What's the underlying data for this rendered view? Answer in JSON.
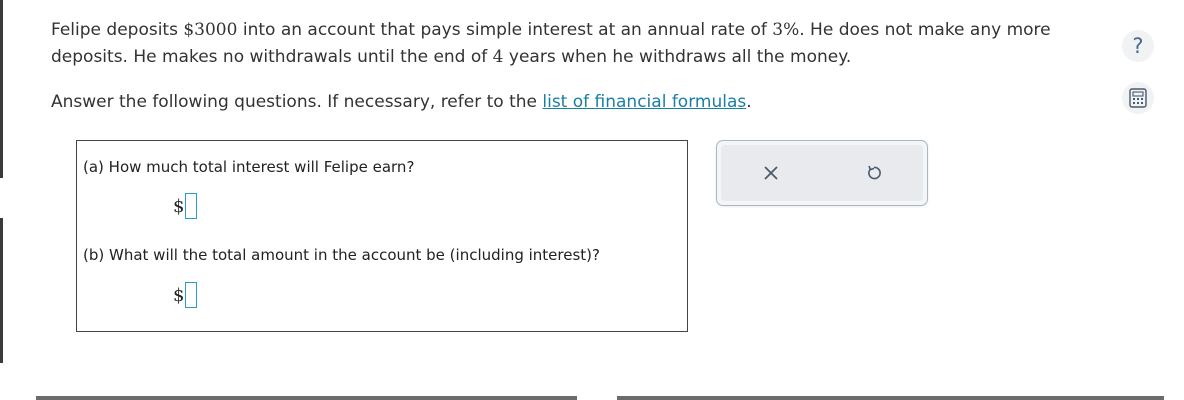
{
  "problem": {
    "line1_before": "Felipe deposits ",
    "deposit_amount": "$3000",
    "line1_mid": " into an account that pays simple interest at an annual rate of ",
    "rate": "3%",
    "line1_after": ". He does not make any more deposits. He makes no withdrawals until the end of ",
    "years": "4",
    "line1_end": " years when he withdraws all the money.",
    "instructions_before": "Answer the following questions. If necessary, refer to the ",
    "formula_link": "list of financial formulas",
    "instructions_after": "."
  },
  "questions": {
    "a_label": "(a) How much total interest will Felipe earn?",
    "b_label": "(b) What will the total amount in the account be (including interest)?",
    "currency": "$",
    "a_value": "",
    "b_value": ""
  },
  "tools": {
    "clear_icon": "x-icon",
    "undo_icon": "undo-icon",
    "help_glyph": "?",
    "calc_icon": "calculator-icon"
  },
  "colors": {
    "link": "#1a7fa3",
    "input_border": "#2a9bd0",
    "icon_gray": "#4a6a8e"
  }
}
